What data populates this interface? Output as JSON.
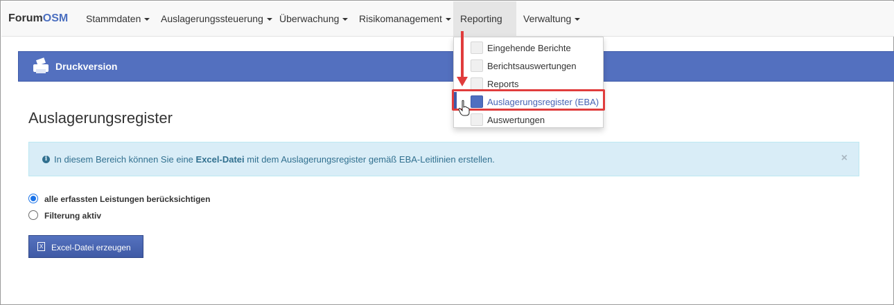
{
  "navbar": {
    "brand_part1": "Forum",
    "brand_part2": "OSM",
    "items": [
      {
        "label": "Stammdaten"
      },
      {
        "label": "Auslagerungssteuerung"
      },
      {
        "label": "Überwachung"
      },
      {
        "label": "Risikomanagement"
      },
      {
        "label": "Reporting"
      },
      {
        "label": "Verwaltung"
      }
    ],
    "active_item": "Reporting"
  },
  "reporting_menu": {
    "items": [
      {
        "label": "Eingehende Berichte",
        "icon": "report-icon"
      },
      {
        "label": "Berichtsauswertungen",
        "icon": "evaluation-icon"
      },
      {
        "label": "Reports",
        "icon": "reports-icon"
      },
      {
        "label": "Auslagerungsregister (EBA)",
        "icon": "printer-icon"
      },
      {
        "label": "Auswertungen",
        "icon": "analysis-icon"
      }
    ],
    "highlighted_item": "Auslagerungsregister (EBA)"
  },
  "print_bar": {
    "label": "Druckversion",
    "icon": "printer-icon"
  },
  "page": {
    "title": "Auslagerungsregister"
  },
  "alert": {
    "text_before": "In diesem Bereich können Sie eine",
    "text_bold": "Excel-Datei",
    "text_after": "mit dem Auslagerungsregister gemäß EBA-Leitlinien erstellen.",
    "close_symbol": "×",
    "icon": "info-icon"
  },
  "options": {
    "items": [
      {
        "label": "alle erfassten Leistungen berücksichtigen",
        "checked": true
      },
      {
        "label": "Filterung aktiv",
        "checked": false
      }
    ]
  },
  "button": {
    "label": "Excel-Datei erzeugen",
    "icon": "excel-file-icon"
  },
  "colors": {
    "accent": "#5370bf",
    "highlight_border": "#e03c3c",
    "alert_bg": "#d9edf7"
  }
}
